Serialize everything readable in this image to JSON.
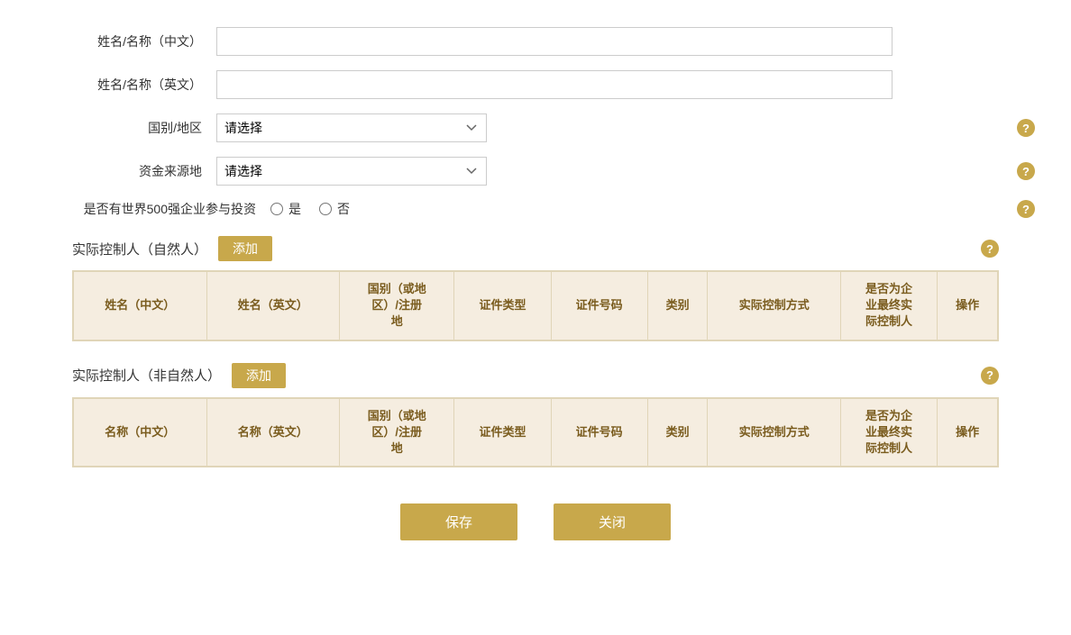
{
  "form": {
    "name_cn_label": "姓名/名称（中文）",
    "name_en_label": "姓名/名称（英文）",
    "country_label": "国别/地区",
    "fund_source_label": "资金来源地",
    "fortune500_label": "是否有世界500强企业参与投资",
    "country_placeholder": "请选择",
    "fund_source_placeholder": "请选择",
    "radio_yes": "是",
    "radio_no": "否",
    "name_cn_value": "",
    "name_en_value": ""
  },
  "natural_person_section": {
    "title": "实际控制人（自然人）",
    "add_label": "添加",
    "help": "?",
    "columns": [
      "姓名（中文）",
      "姓名（英文）",
      "国别（或地\n区）/注册\n地",
      "证件类型",
      "证件号码",
      "类别",
      "实际控制方式",
      "是否为企\n业最终实\n际控制人",
      "操作"
    ]
  },
  "non_natural_person_section": {
    "title": "实际控制人（非自然人）",
    "add_label": "添加",
    "help": "?",
    "columns": [
      "名称（中文）",
      "名称（英文）",
      "国别（或地\n区）/注册\n地",
      "证件类型",
      "证件号码",
      "类别",
      "实际控制方式",
      "是否为企\n业最终实\n际控制人",
      "操作"
    ]
  },
  "actions": {
    "save_label": "保存",
    "close_label": "关闭"
  },
  "icons": {
    "help": "?"
  }
}
